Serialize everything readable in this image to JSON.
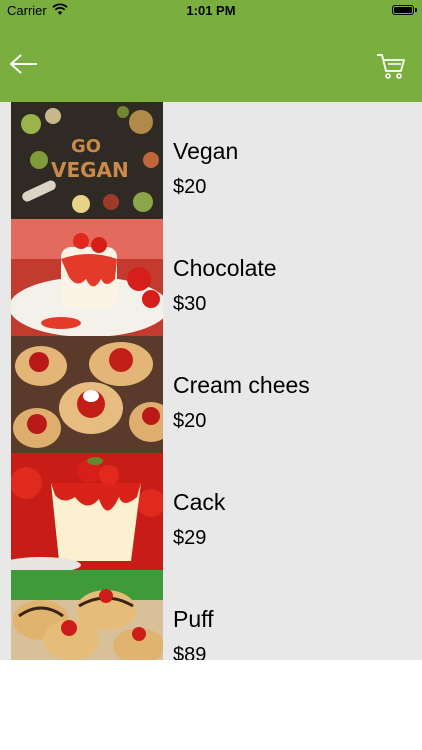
{
  "status_bar": {
    "carrier": "Carrier",
    "time": "1:01 PM"
  },
  "navbar": {
    "back_icon": "back-arrow-icon",
    "cart_icon": "cart-icon"
  },
  "products": [
    {
      "name": "Vegan",
      "price": "$20",
      "image_text": "GO VEGAN"
    },
    {
      "name": "Chocolate",
      "price": "$30"
    },
    {
      "name": "Cream chees",
      "price": "$20"
    },
    {
      "name": "Cack",
      "price": "$29"
    },
    {
      "name": "Puff",
      "price": "$89"
    }
  ],
  "colors": {
    "accent": "#7aaf3f",
    "list_bg": "#e8e8e8"
  }
}
